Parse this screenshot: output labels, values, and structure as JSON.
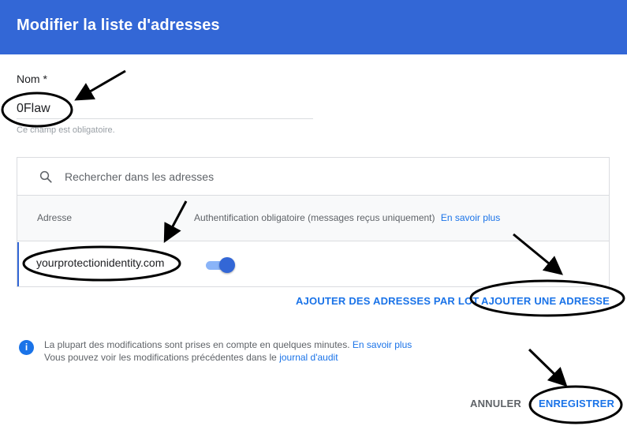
{
  "header": {
    "title": "Modifier la liste d'adresses"
  },
  "name_field": {
    "label": "Nom *",
    "value": "0Flaw",
    "help": "Ce champ est obligatoire."
  },
  "search": {
    "placeholder": "Rechercher dans les adresses",
    "icon": "search-icon"
  },
  "table": {
    "columns": {
      "address": "Adresse",
      "auth": "Authentification obligatoire (messages reçus uniquement)",
      "auth_link": "En savoir plus"
    },
    "rows": [
      {
        "address": "yourprotectionidentity.com",
        "auth_required": true
      }
    ]
  },
  "actions": {
    "bulk_add": "AJOUTER DES ADRESSES PAR LOT",
    "add": "AJOUTER UNE ADRESSE"
  },
  "info": {
    "icon": "info-icon",
    "line1": "La plupart des modifications sont prises en compte en quelques minutes.",
    "line1_link": "En savoir plus",
    "line2": "Vous pouvez voir les modifications précédentes dans le",
    "line2_link": "journal d'audit"
  },
  "footer": {
    "cancel": "ANNULER",
    "save": "ENREGISTRER"
  },
  "colors": {
    "header": "#3367d6",
    "accent": "#1a73e8",
    "toggle_track": "#8ab4f8"
  }
}
